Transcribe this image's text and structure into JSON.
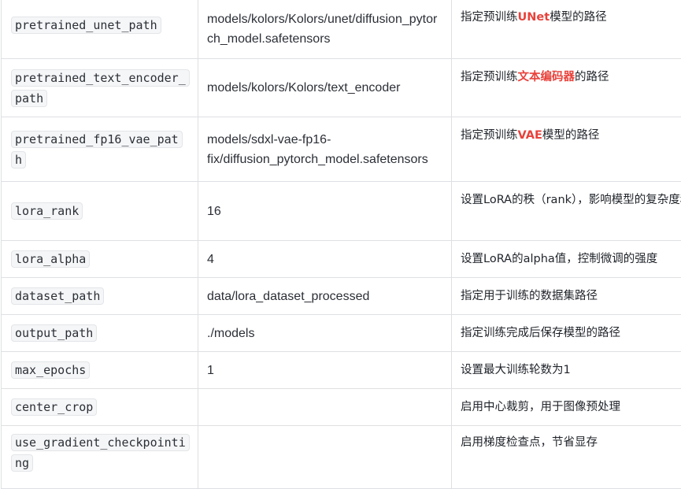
{
  "rows": [
    {
      "param": "pretrained_unet_path",
      "value": "models/kolors/Kolors/unet/diffusion_pytorch_model.safetensors",
      "desc": {
        "pre": "指定预训练",
        "hl": "UNet",
        "post": "模型的路径"
      }
    },
    {
      "param": "pretrained_text_encoder_path",
      "value": "models/kolors/Kolors/text_encoder",
      "desc": {
        "pre": "指定预训练",
        "hl": "文本编码器",
        "post": "的路径"
      }
    },
    {
      "param": "pretrained_fp16_vae_path",
      "value": "models/sdxl-vae-fp16-fix/diffusion_pytorch_model.safetensors",
      "desc": {
        "pre": "指定预训练",
        "hl": "VAE",
        "post": "模型的路径"
      }
    },
    {
      "param": "lora_rank",
      "value": "16",
      "desc": {
        "text": "设置LoRA的秩（rank），影响模型的复杂度和性能"
      }
    },
    {
      "param": "lora_alpha",
      "value": "4",
      "desc": {
        "text": "设置LoRA的alpha值，控制微调的强度"
      }
    },
    {
      "param": "dataset_path",
      "value": "data/lora_dataset_processed",
      "desc": {
        "text": "指定用于训练的数据集路径"
      }
    },
    {
      "param": "output_path",
      "value": "./models",
      "desc": {
        "text": "指定训练完成后保存模型的路径"
      }
    },
    {
      "param": "max_epochs",
      "value": "1",
      "desc": {
        "text": "设置最大训练轮数为1"
      }
    },
    {
      "param": "center_crop",
      "value": "",
      "desc": {
        "text": "启用中心裁剪，用于图像预处理"
      }
    },
    {
      "param": "use_gradient_checkpointing",
      "value": "",
      "desc": {
        "text": "启用梯度检查点，节省显存"
      }
    }
  ]
}
